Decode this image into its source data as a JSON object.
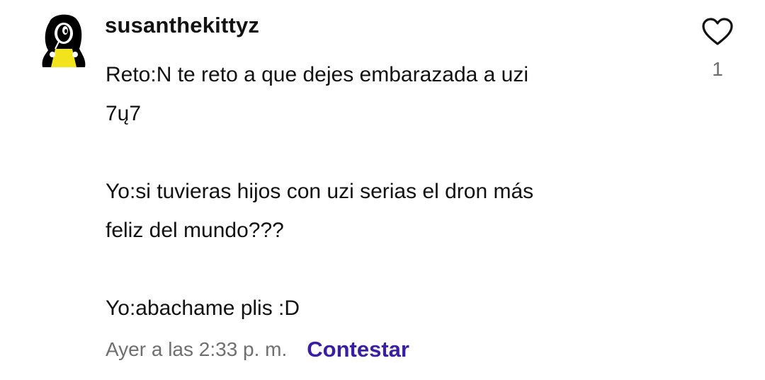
{
  "comment": {
    "username": "susanthekittyz",
    "body": [
      "Reto:N te reto a que dejes embarazada a uzi\n7ų7",
      "Yo:si tuvieras hijos con uzi serias el dron más\nfeliz del mundo???",
      "Yo:abachame plis :D"
    ],
    "timestamp": "Ayer a las 2:33 p. m.",
    "reply_label": "Contestar",
    "like_count": "1",
    "avatar": {
      "icon": "avatar-character-icon",
      "colors": [
        "#000000",
        "#f2e41c",
        "#ffffff"
      ]
    }
  },
  "colors": {
    "text": "#121212",
    "muted": "#6f6f6f",
    "accent": "#3b1fa3",
    "background": "#ffffff"
  }
}
